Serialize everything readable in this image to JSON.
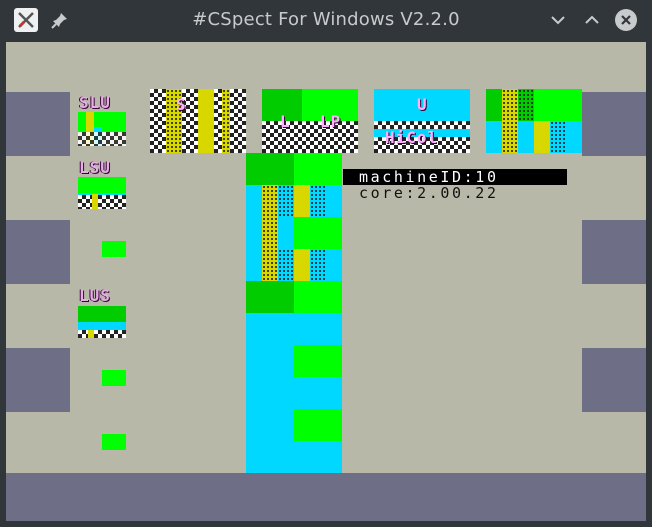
{
  "window": {
    "title": "#CSpect For Windows V2.2.0",
    "app_icon": "cspect-app-icon",
    "pin_icon": "pin-icon",
    "minimize_icon": "chevron-down-icon",
    "maximize_icon": "chevron-up-icon",
    "close_icon": "close-icon"
  },
  "screen": {
    "border_color": "#6e6e86",
    "paper_color": "#b8b8a8",
    "layer_labels": {
      "slu": "SLU",
      "lsu": "LSU",
      "lus": "LUS",
      "s": "S",
      "l": "L",
      "lp": "LP",
      "u": "U",
      "hicol": "HiCol"
    },
    "info": {
      "machine_id": "machineID:10",
      "core": "core:2.00.22"
    }
  }
}
